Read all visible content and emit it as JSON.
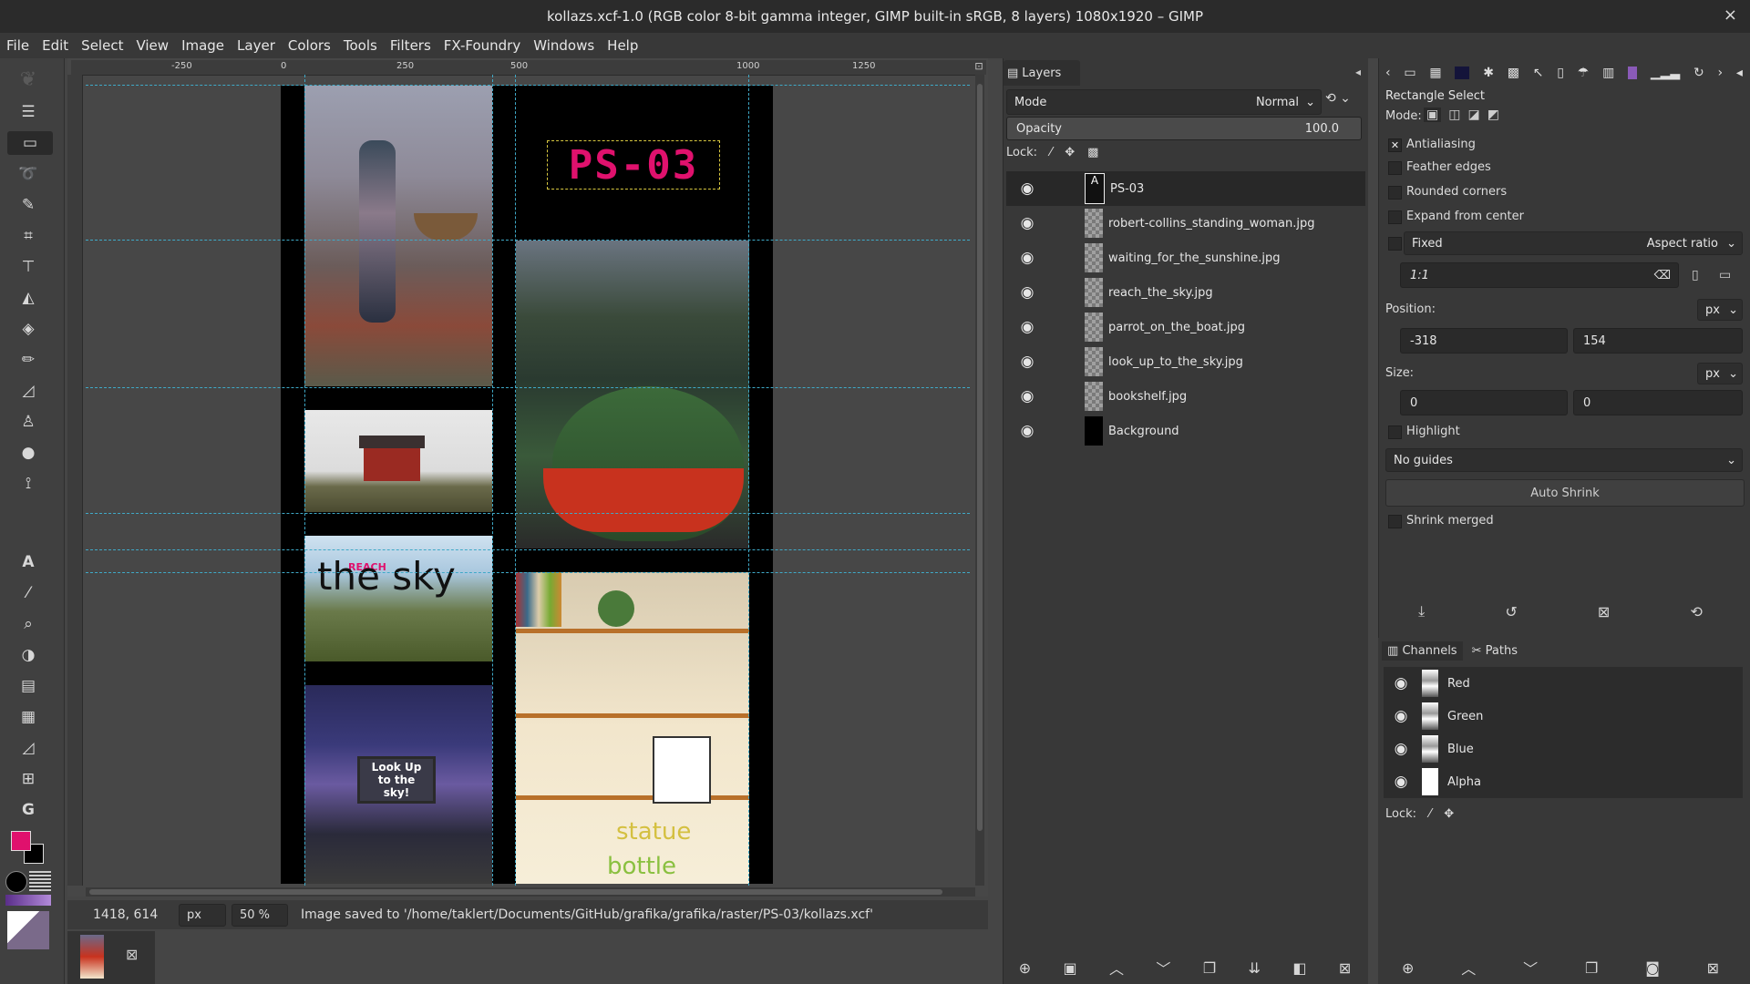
{
  "window": {
    "title": "kollazs.xcf-1.0 (RGB color 8-bit gamma integer, GIMP built-in sRGB, 8 layers) 1080x1920 – GIMP",
    "close": "×"
  },
  "menu": [
    "File",
    "Edit",
    "Select",
    "View",
    "Image",
    "Layer",
    "Colors",
    "Tools",
    "Filters",
    "FX-Foundry",
    "Windows",
    "Help"
  ],
  "ruler": {
    "h_ticks": [
      "-250",
      "0",
      "250",
      "500",
      "1000",
      "1250"
    ]
  },
  "canvas": {
    "image_title_text": "PS-03",
    "poster_text_reach": "REACH",
    "poster_text_sky": "the sky",
    "sign_text": "Look Up to the sky!",
    "statue_text": "statue",
    "bottle_text": "bottle"
  },
  "status": {
    "coords": "1418, 614",
    "unit": "px",
    "zoom": "50 %",
    "message": "Image saved to '/home/taklert/Documents/GitHub/grafika/grafika/raster/PS-03/kollazs.xcf'"
  },
  "layers_panel": {
    "tab": "Layers",
    "mode_label": "Mode",
    "mode_value": "Normal",
    "opacity_label": "Opacity",
    "opacity_value": "100.0",
    "lock_label": "Lock:",
    "layers": [
      "PS-03",
      "robert-collins_standing_woman.jpg",
      "waiting_for_the_sunshine.jpg",
      "reach_the_sky.jpg",
      "parrot_on_the_boat.jpg",
      "look_up_to_the_sky.jpg",
      "bookshelf.jpg",
      "Background"
    ]
  },
  "tool_options": {
    "title": "Rectangle Select",
    "mode_label": "Mode:",
    "antialiasing": "Antialiasing",
    "feather": "Feather edges",
    "rounded": "Rounded corners",
    "expand": "Expand from center",
    "fixed": "Fixed",
    "aspect": "Aspect ratio",
    "ratio_value": "1:1",
    "position_label": "Position:",
    "pos_unit": "px",
    "pos_x": "-318",
    "pos_y": "154",
    "size_label": "Size:",
    "size_unit": "px",
    "size_w": "0",
    "size_h": "0",
    "highlight": "Highlight",
    "guides": "No guides",
    "auto_shrink": "Auto Shrink",
    "shrink_merged": "Shrink merged"
  },
  "channels_panel": {
    "tab_channels": "Channels",
    "tab_paths": "Paths",
    "channels": [
      "Red",
      "Green",
      "Blue",
      "Alpha"
    ],
    "lock_label": "Lock:"
  },
  "colors": {
    "fg": "#e0116d",
    "bg": "#000000",
    "accent_text": "#e0116d",
    "guide": "#3fa9c7"
  }
}
